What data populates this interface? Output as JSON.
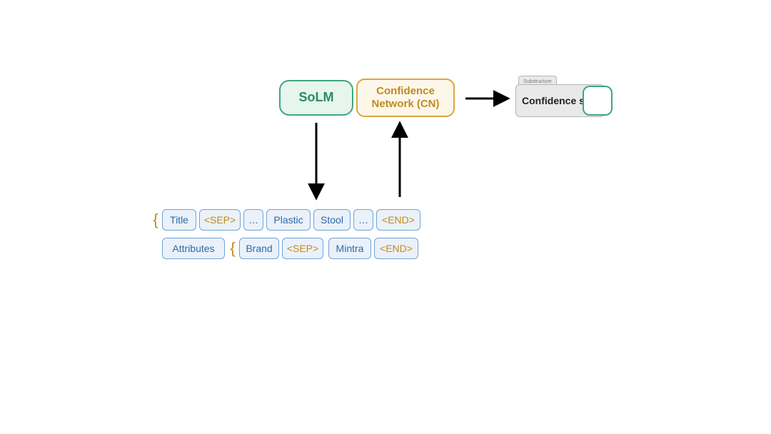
{
  "top": {
    "solm": "SoLM",
    "cn": "Confidence Network (CN)",
    "conf_tab": "Substructure",
    "conf_label": "Confidence score"
  },
  "tokens_row1": {
    "brace": "{",
    "t0": "Title",
    "t1": "<SEP>",
    "t2": "…",
    "t3": "Plastic",
    "t4": "Stool",
    "t5": "…",
    "t6": "<END>"
  },
  "tokens_row2": {
    "t0": "Attributes",
    "brace": "{",
    "t1": "Brand",
    "t2": "<SEP>",
    "t3": "Mintra",
    "t4": "<END>"
  }
}
